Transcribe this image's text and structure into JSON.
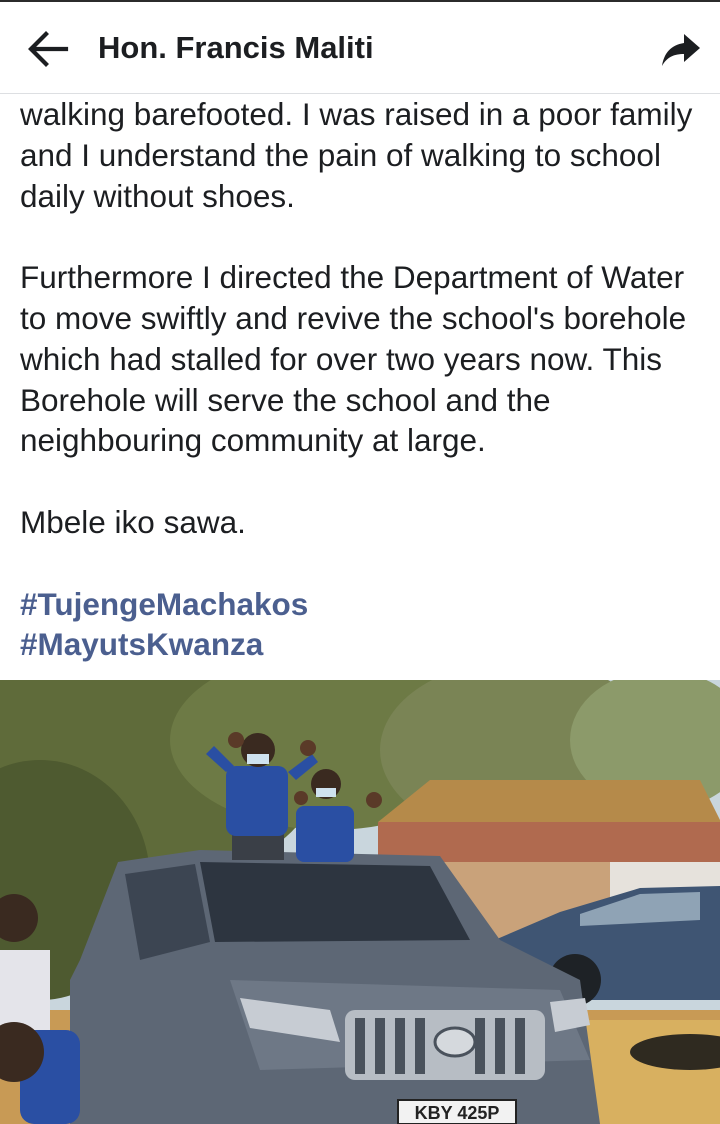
{
  "header": {
    "title": "Hon. Francis Maliti",
    "back_icon": "arrow-left-icon",
    "share_icon": "share-arrow-icon"
  },
  "post": {
    "paragraphs": [
      "walking barefooted. I was raised in a poor family and I understand the pain of walking to school daily without shoes.",
      "Furthermore I directed the Department of Water to move swiftly and revive the school's borehole which had stalled for over two years now. This Borehole will serve the school and the neighbouring community at large.",
      "Mbele iko sawa."
    ],
    "hashtags": [
      "#TujengeMachakos",
      "#MayutsKwanza"
    ]
  },
  "photo": {
    "plate_text": "KBY 425P"
  },
  "colors": {
    "hashtag": "#4b5f8f",
    "text": "#1c1e21",
    "divider": "#dddfe2"
  }
}
